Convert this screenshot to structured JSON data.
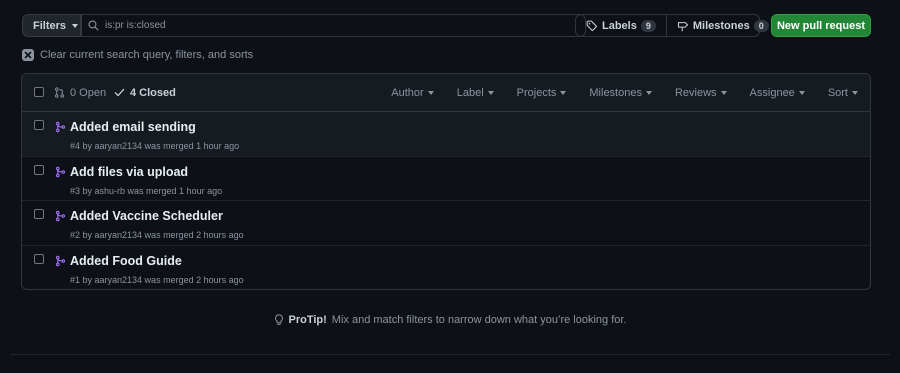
{
  "toolbar": {
    "filters_label": "Filters",
    "search_value": "is:pr is:closed",
    "labels_label": "Labels",
    "labels_count": "9",
    "milestones_label": "Milestones",
    "milestones_count": "0",
    "new_pr_label": "New pull request"
  },
  "clear_query": "Clear current search query, filters, and sorts",
  "header": {
    "open_label": "0 Open",
    "closed_label": "4 Closed",
    "filters": [
      "Author",
      "Label",
      "Projects",
      "Milestones",
      "Reviews",
      "Assignee",
      "Sort"
    ]
  },
  "pulls": [
    {
      "title": "Added email sending",
      "meta": "#4 by aaryan2134 was merged 1 hour ago"
    },
    {
      "title": "Add files via upload",
      "meta": "#3 by ashu-rb was merged 1 hour ago"
    },
    {
      "title": "Added Vaccine Scheduler",
      "meta": "#2 by aaryan2134 was merged 2 hours ago"
    },
    {
      "title": "Added Food Guide",
      "meta": "#1 by aaryan2134 was merged 2 hours ago"
    }
  ],
  "protip": {
    "label": "ProTip!",
    "text": "Mix and match filters to narrow down what you’re looking for."
  },
  "colors": {
    "background": "#0d1117",
    "merged_icon": "#a371f7",
    "primary_button": "#238636"
  },
  "icons": {
    "search": "search-icon",
    "label": "tag-icon",
    "milestone": "milestone-icon",
    "pr_open": "git-pull-request-icon",
    "check": "check-icon",
    "merged": "git-merge-icon",
    "bulb": "light-bulb-icon"
  }
}
